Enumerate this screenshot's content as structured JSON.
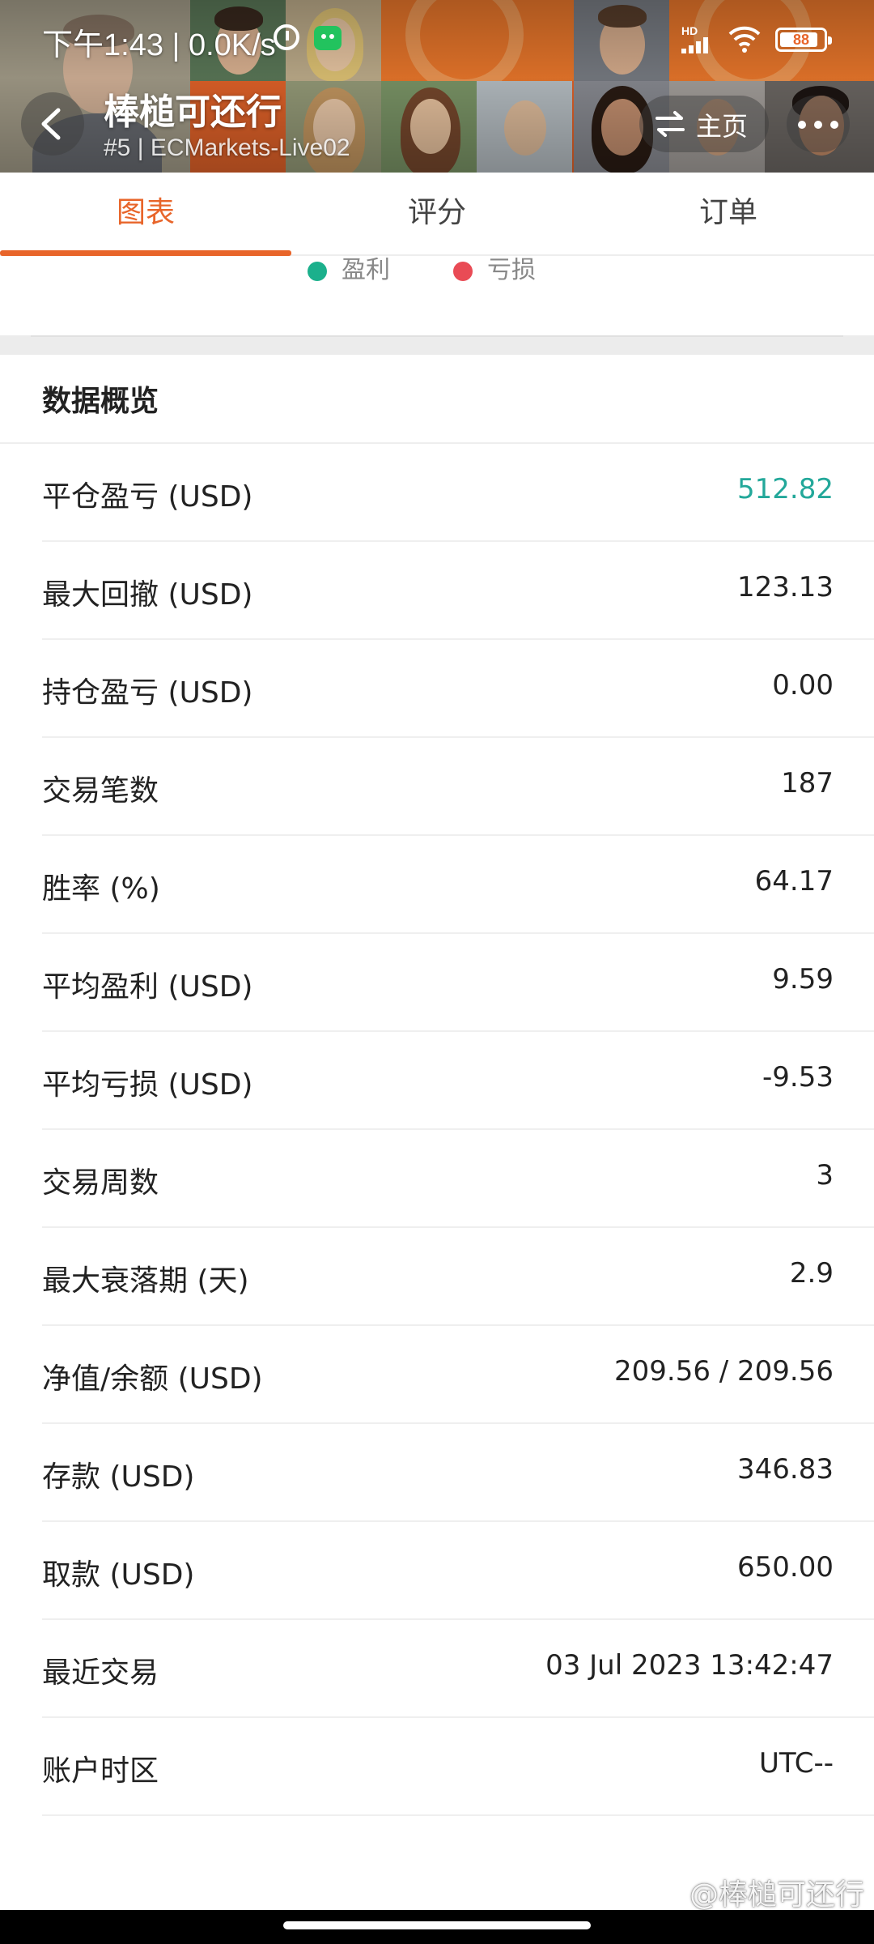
{
  "status_bar": {
    "time_speed": "下午1:43 | 0.0K/s",
    "hd_label": "HD",
    "battery": "88",
    "battery_level": 0.88
  },
  "nav": {
    "title": "棒槌可还行",
    "subtitle": "#5 | ECMarkets-Live02",
    "home_label": "主页",
    "back_icon": "chevron-left-icon",
    "switch_icon": "switch-arrows-icon",
    "more_icon": "more-dots-icon"
  },
  "tabs": [
    {
      "label": "图表",
      "active": true
    },
    {
      "label": "评分",
      "active": false
    },
    {
      "label": "订单",
      "active": false
    }
  ],
  "legend": [
    {
      "label": "盈利",
      "color": "#1bb08c"
    },
    {
      "label": "亏损",
      "color": "#e94b55"
    }
  ],
  "overview": {
    "title": "数据概览",
    "rows": [
      {
        "label": "平仓盈亏 (USD)",
        "value": "512.82"
      },
      {
        "label": "最大回撤 (USD)",
        "value": "123.13"
      },
      {
        "label": "持仓盈亏 (USD)",
        "value": "0.00"
      },
      {
        "label": "交易笔数",
        "value": "187"
      },
      {
        "label": "胜率 (%)",
        "value": "64.17"
      },
      {
        "label": "平均盈利 (USD)",
        "value": "9.59"
      },
      {
        "label": "平均亏损 (USD)",
        "value": "-9.53"
      },
      {
        "label": "交易周数",
        "value": "3"
      },
      {
        "label": "最大衰落期 (天)",
        "value": "2.9"
      },
      {
        "label": "净值/余额 (USD)",
        "value": "209.56 / 209.56"
      },
      {
        "label": "存款 (USD)",
        "value": "346.83"
      },
      {
        "label": "取款 (USD)",
        "value": "650.00"
      },
      {
        "label": "最近交易",
        "value": "03 Jul 2023 13:42:47"
      },
      {
        "label": "账户时区",
        "value": "UTC--"
      }
    ]
  },
  "colors": {
    "accent": "#e8652a",
    "profit": "#23a89a"
  },
  "watermark": "@棒槌可还行"
}
